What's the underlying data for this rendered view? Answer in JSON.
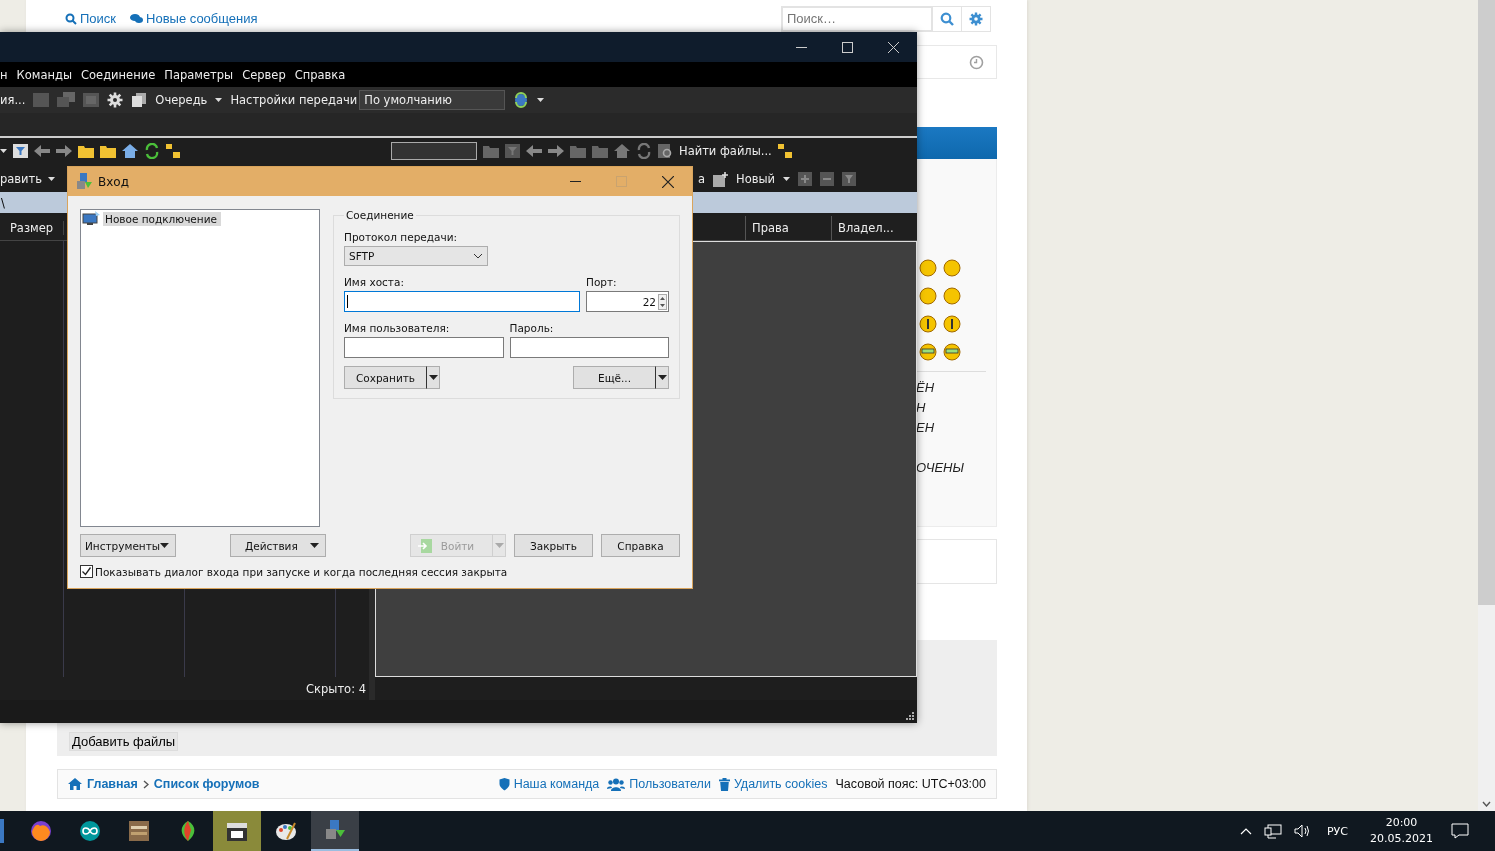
{
  "browser_page": {
    "top_links": [
      {
        "label": "Поиск"
      },
      {
        "label": "Новые сообщения"
      }
    ],
    "search": {
      "placeholder": "Поиск…"
    },
    "post_text_fragments": [
      "ЁН",
      "Н",
      "ЕН",
      "ОЧЕНЫ"
    ],
    "attach_button": "Добавить файлы",
    "breadcrumbs": [
      "Главная",
      "Список форумов"
    ],
    "footer_links": [
      {
        "label": "Наша команда",
        "kind": "shield"
      },
      {
        "label": "Пользователи",
        "kind": "users"
      },
      {
        "label": "Удалить cookies",
        "kind": "trash"
      }
    ],
    "timezone": "Часовой пояс: UTC+03:00"
  },
  "app_window": {
    "menu": [
      "н",
      "Команды",
      "Соединение",
      "Параметры",
      "Сервер",
      "Справка"
    ],
    "toolbar": {
      "cut_label": "ия...",
      "queue": "Очередь",
      "transfer_settings_label": "Настройки передачи",
      "transfer_preset": "По умолчанию"
    },
    "left_edit": "равить",
    "remote_cut": "а",
    "remote_new": "Новый",
    "remote_find": "Найти файлы...",
    "left_path": "\\",
    "left_columns": [
      "Размер"
    ],
    "right_columns": [
      "Права",
      "Владел..."
    ],
    "status": "Скрыто: 4"
  },
  "login_dialog": {
    "title": "Вход",
    "sites": [
      {
        "label": "Новое подключение",
        "selected": true
      }
    ],
    "group_title": "Соединение",
    "protocol_label": "Протокол передачи:",
    "protocol": "SFTP",
    "host_label": "Имя хоста:",
    "host_focused": true,
    "port_label": "Порт:",
    "port": "22",
    "user_label": "Имя пользователя:",
    "password_label": "Пароль:",
    "save_button": "Сохранить",
    "more_button": "Ещё...",
    "tools_button": "Инструменты",
    "actions_button": "Действия",
    "buttons": [
      {
        "label": "Войти",
        "disabled": true,
        "kind": "login"
      },
      {
        "label": "Закрыть",
        "disabled": false,
        "kind": "plain"
      },
      {
        "label": "Справка",
        "disabled": false,
        "kind": "plain"
      }
    ],
    "show_on_startup": {
      "label": "Показывать диалог входа при запуске и когда последняя сессия закрыта",
      "checked": true
    }
  },
  "taskbar": {
    "apps": [
      {
        "kind": "fox",
        "selected": false,
        "flashing": false
      },
      {
        "kind": "infinity",
        "selected": false,
        "flashing": false
      },
      {
        "kind": "box",
        "selected": false,
        "flashing": false
      },
      {
        "kind": "leaf",
        "selected": false,
        "flashing": false
      },
      {
        "kind": "clapper",
        "selected": false,
        "flashing": true
      },
      {
        "kind": "palette",
        "selected": false,
        "flashing": false
      },
      {
        "kind": "transfer",
        "selected": true,
        "flashing": false
      }
    ],
    "language": "РУС",
    "time": "20:00",
    "date": "20.05.2021"
  }
}
